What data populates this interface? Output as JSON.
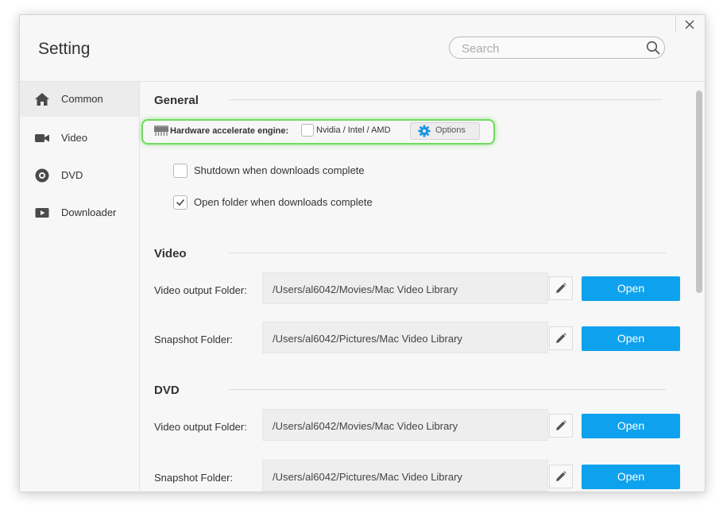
{
  "window": {
    "title": "Setting"
  },
  "search": {
    "placeholder": "Search"
  },
  "sidebar": {
    "items": [
      {
        "label": "Common",
        "icon": "home-icon"
      },
      {
        "label": "Video",
        "icon": "video-camera-icon"
      },
      {
        "label": "DVD",
        "icon": "disc-icon"
      },
      {
        "label": "Downloader",
        "icon": "play-icon"
      }
    ],
    "active": "Common"
  },
  "general": {
    "title": "General",
    "hardware_label": "Hardware accelerate engine:",
    "hardware_vendor": "Nvidia /  Intel / AMD",
    "hardware_checked": false,
    "options_label": "Options",
    "shutdown_label": "Shutdown when downloads complete",
    "shutdown_checked": false,
    "open_folder_label": "Open folder when downloads complete",
    "open_folder_checked": true
  },
  "video": {
    "title": "Video",
    "output_label": "Video output Folder:",
    "output_path": "/Users/al6042/Movies/Mac Video Library",
    "snapshot_label": "Snapshot Folder:",
    "snapshot_path": "/Users/al6042/Pictures/Mac Video Library",
    "open_label": "Open"
  },
  "dvd": {
    "title": "DVD",
    "output_label": "Video output Folder:",
    "output_path": "/Users/al6042/Movies/Mac Video Library",
    "snapshot_label": "Snapshot Folder:",
    "snapshot_path": "/Users/al6042/Pictures/Mac Video Library",
    "open_label": "Open"
  },
  "colors": {
    "accent": "#0ea2ee",
    "highlight": "#6fdc5c",
    "gear": "#1a93e0"
  }
}
